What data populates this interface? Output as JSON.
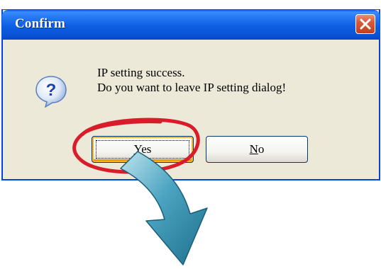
{
  "dialog": {
    "title": "Confirm",
    "message_line1": "IP setting success.",
    "message_line2": "Do you want to leave IP setting dialog!",
    "icon": "question-icon",
    "close_icon": "close-icon"
  },
  "buttons": {
    "yes_mnemonic": "Y",
    "yes_rest": "es",
    "no_mnemonic": "N",
    "no_rest": "o"
  },
  "annotation": {
    "highlight_color": "#d81c2a",
    "arrow_color": "#2a8aa8",
    "arrow_icon": "curved-down-arrow-icon"
  },
  "colors": {
    "titlebar": "#0a55d8",
    "dialog_bg": "#ece9d8",
    "close_button": "#c43d1c"
  }
}
